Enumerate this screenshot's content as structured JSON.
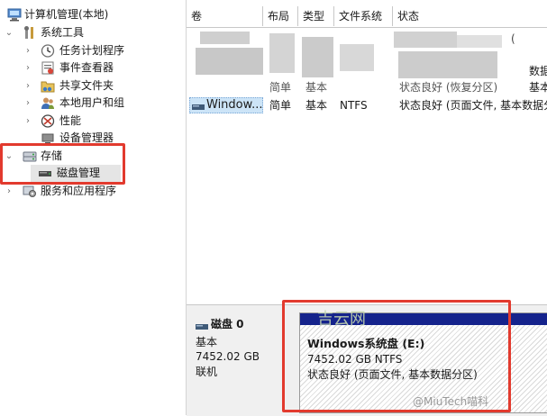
{
  "tree": {
    "root": "计算机管理(本地)",
    "system_tools": "系统工具",
    "task_scheduler": "任务计划程序",
    "event_viewer": "事件查看器",
    "shared_folders": "共享文件夹",
    "local_users_groups": "本地用户和组",
    "performance": "性能",
    "device_manager": "设备管理器",
    "storage": "存储",
    "disk_management": "磁盘管理",
    "services_apps": "服务和应用程序"
  },
  "volume_list": {
    "columns": [
      "卷",
      "布局",
      "类型",
      "文件系统",
      "状态"
    ],
    "partial_row_1": [
      "(",
      "简单",
      "基本",
      "",
      "状态良好 (恢复分区)",
      "基本"
    ],
    "visible_row": {
      "volume": "Window...",
      "layout": "简单",
      "type": "基本",
      "fs": "NTFS",
      "status": "状态良好 (页面文件, 基本数据分区)"
    },
    "clipped_right_1": "(",
    "clipped_right_2": "数据",
    "clipped_right_3": "基本"
  },
  "disk": {
    "name": "磁盘 0",
    "type": "基本",
    "size": "7452.02 GB",
    "status": "联机",
    "partition": {
      "title": "Windows系统盘 (E:)",
      "size_fs": "7452.02 GB NTFS",
      "status": "状态良好 (页面文件, 基本数据分区)"
    }
  },
  "watermarks": {
    "center": "吉云网",
    "corner": "@MiuTech喵科"
  },
  "colors": {
    "highlight_red": "#e23a2e",
    "partition_bar": "#15238c",
    "selection": "#cce4f7"
  }
}
